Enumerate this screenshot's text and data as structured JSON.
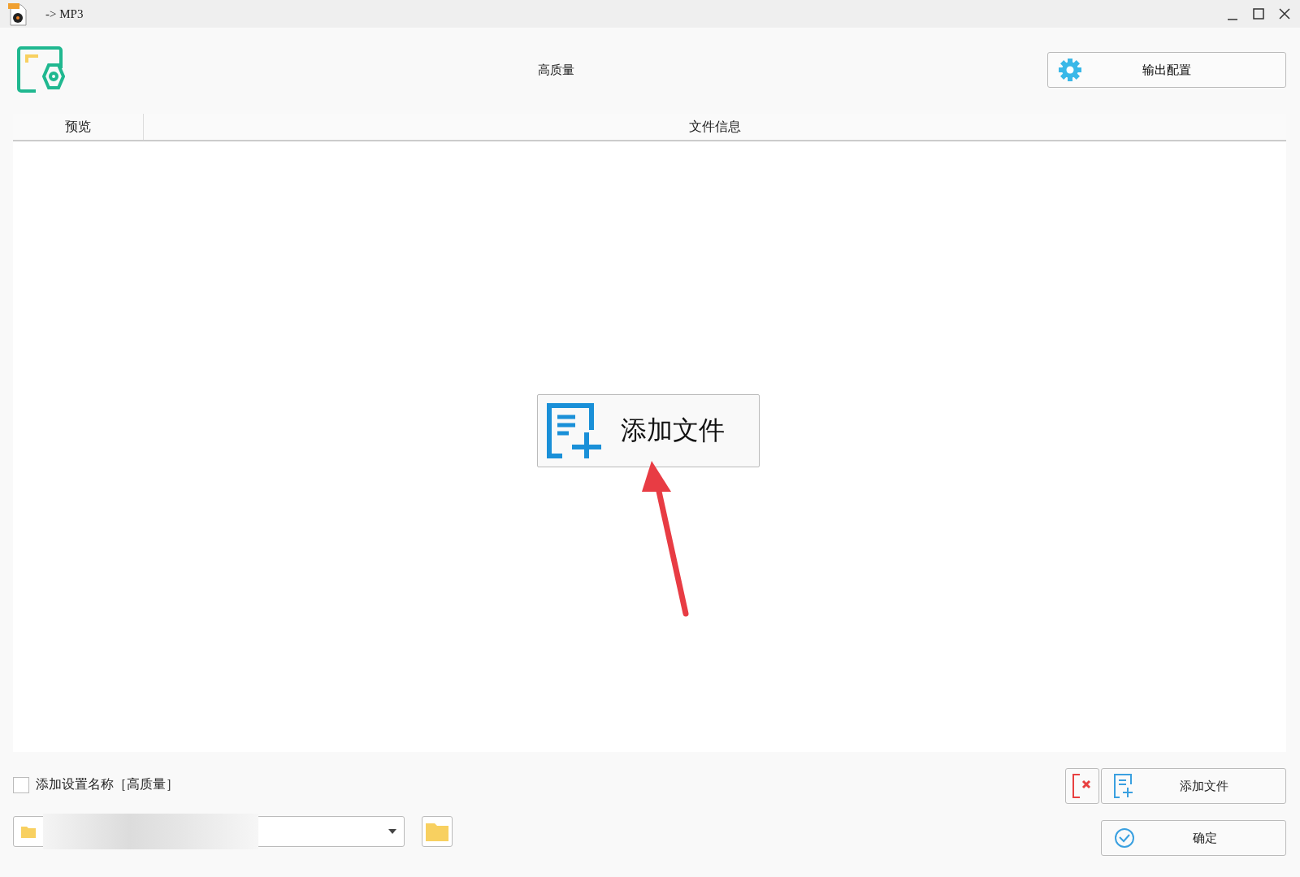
{
  "window": {
    "title": "-> MP3"
  },
  "header": {
    "preset": "高质量",
    "output_button": "输出配置"
  },
  "table": {
    "columns": [
      "预览",
      "文件信息"
    ]
  },
  "center_button": "添加文件",
  "footer": {
    "checkbox": {
      "label": "添加设置名称［高质量］",
      "checked": false
    },
    "add_button": "添加文件",
    "ok_button": "确定"
  }
}
